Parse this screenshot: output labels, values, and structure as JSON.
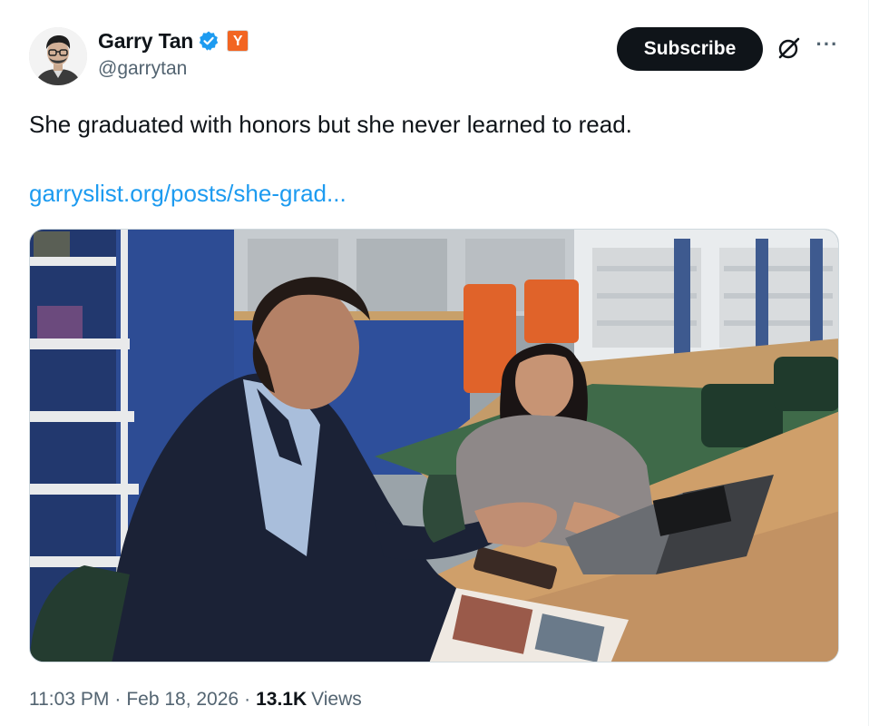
{
  "author": {
    "display_name": "Garry Tan",
    "handle": "@garrytan",
    "verified": true,
    "affiliate_badge": "Y",
    "affiliate_badge_color": "#f26522",
    "avatar_icon": "user-avatar-photo"
  },
  "actions": {
    "subscribe_label": "Subscribe",
    "grok_icon": "grok-icon",
    "more_icon": "more-icon",
    "more_glyph": "···"
  },
  "tweet": {
    "text": "She graduated with honors but she never learned to read.",
    "link": "garryslist.org/posts/she-grad..."
  },
  "media": {
    "type": "video-thumbnail",
    "description_icon": "video-still-icon"
  },
  "meta": {
    "time": "11:03 PM",
    "separator": "·",
    "date": "Feb 18, 2026",
    "views_count": "13.1K",
    "views_label": "Views"
  },
  "colors": {
    "text": "#0f1419",
    "secondary": "#536471",
    "link": "#1d9bf0",
    "verified": "#1d9bf0",
    "button_bg": "#0f1419"
  }
}
